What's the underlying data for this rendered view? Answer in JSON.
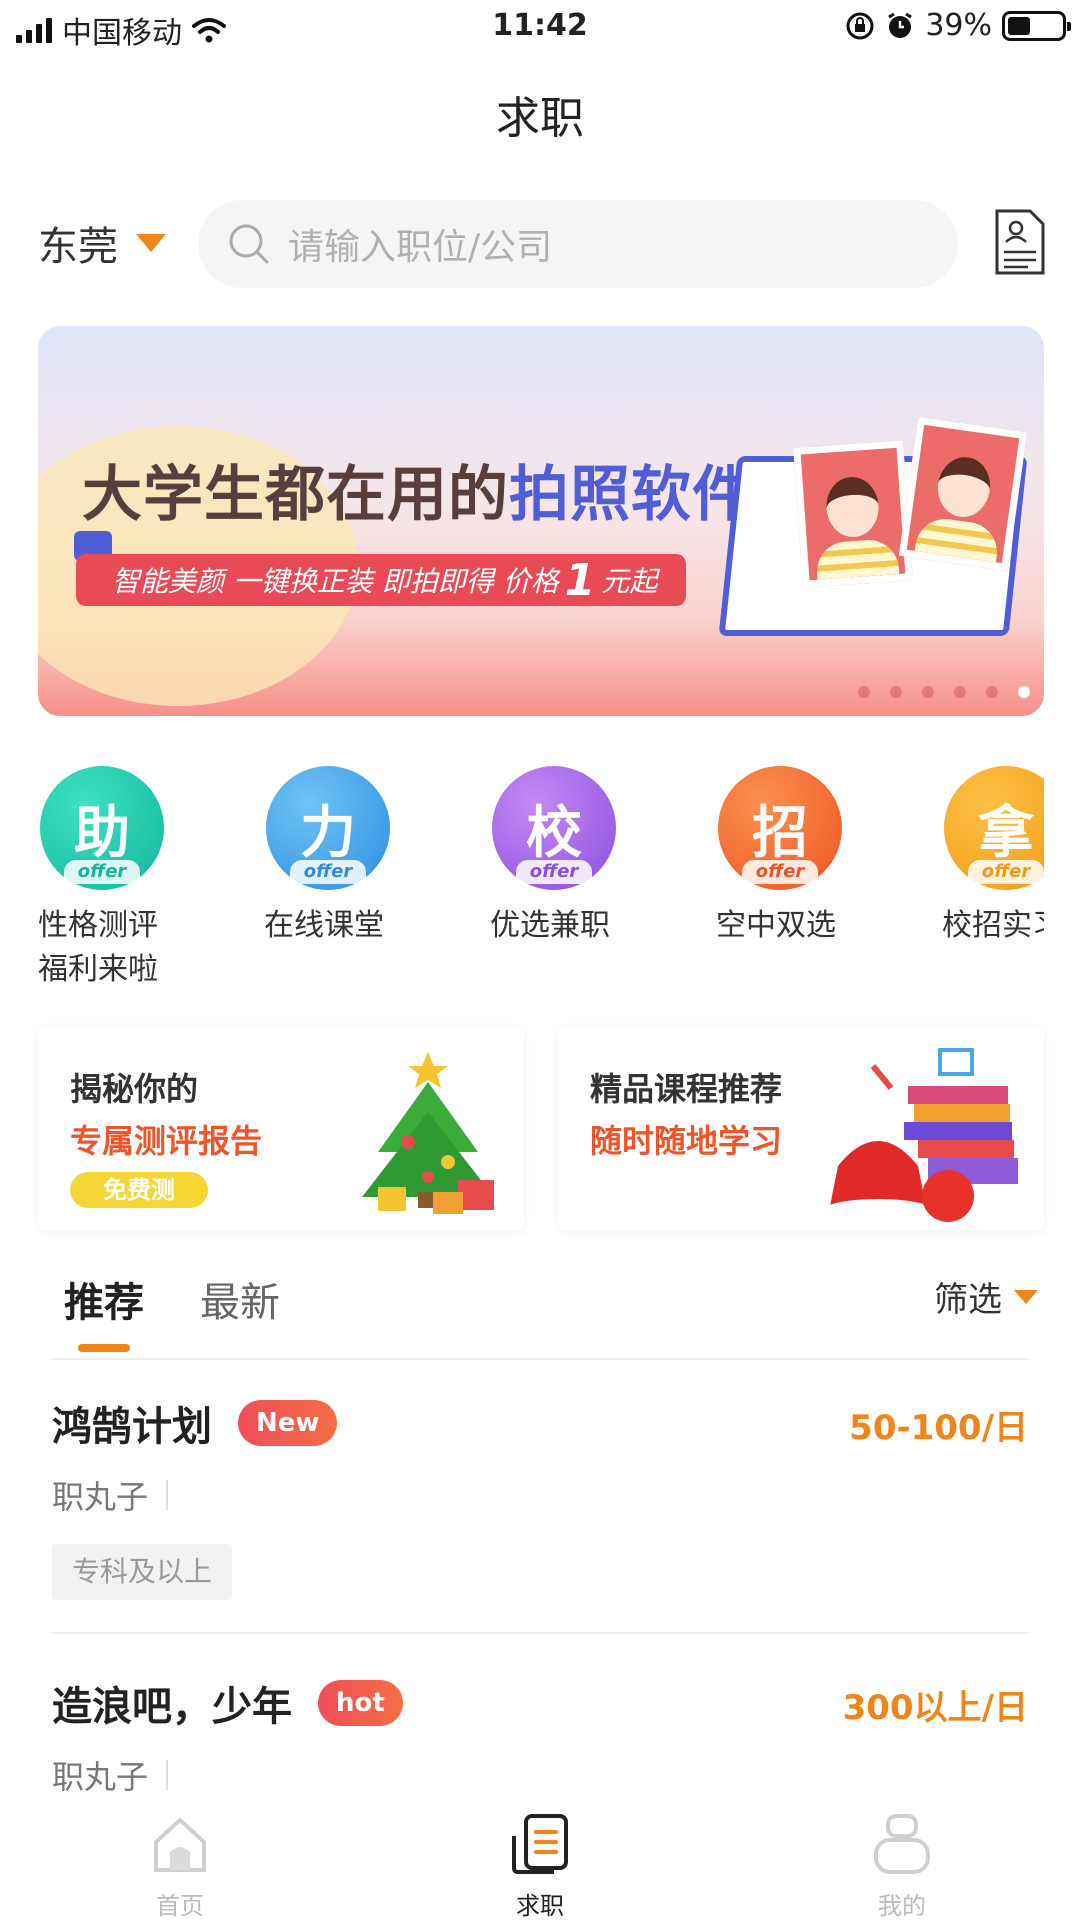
{
  "status_bar": {
    "carrier": "中国移动",
    "time": "11:42",
    "battery": "39%"
  },
  "header": {
    "title": "求职"
  },
  "search": {
    "city": "东莞",
    "placeholder": "请输入职位/公司"
  },
  "banner": {
    "headline_part1": "大学生都在用的",
    "headline_part2": "拍照软件",
    "sub_part1": "智能美颜 一键换正装 即拍即得  价格",
    "sub_price": "1",
    "sub_part2": "元起",
    "page_count": 6,
    "active_page": 6
  },
  "categories": [
    {
      "glyph": "助",
      "offer": "offer",
      "label1": "性格测评",
      "label2": "福利来啦",
      "color_a": "#3fe0c4",
      "color_b": "#11b79a"
    },
    {
      "glyph": "力",
      "offer": "offer",
      "label1": "在线课堂",
      "label2": "",
      "color_a": "#6fc4f6",
      "color_b": "#2d8de0"
    },
    {
      "glyph": "校",
      "offer": "offer",
      "label1": "优选兼职",
      "label2": "",
      "color_a": "#c58af4",
      "color_b": "#8a4ee0"
    },
    {
      "glyph": "招",
      "offer": "offer",
      "label1": "空中双选",
      "label2": "",
      "color_a": "#fb9050",
      "color_b": "#ef5520"
    },
    {
      "glyph": "拿",
      "offer": "offer",
      "label1": "校招实习",
      "label2": "",
      "color_a": "#fdc046",
      "color_b": "#f39a12"
    }
  ],
  "promo_cards": [
    {
      "line1": "揭秘你的",
      "line2": "专属测评报告",
      "pill": "免费测"
    },
    {
      "line1": "精品课程推荐",
      "line2": "随时随地学习",
      "pill": ""
    }
  ],
  "tabs": {
    "recommended": "推荐",
    "latest": "最新",
    "filter": "筛选"
  },
  "jobs": [
    {
      "title": "鸿鹄计划",
      "badge": "New",
      "pay": "50-100/日",
      "company": "职丸子",
      "requirement": "专科及以上"
    },
    {
      "title": "造浪吧，少年",
      "badge": "hot",
      "pay": "300以上/日",
      "company": "职丸子",
      "requirement": ""
    }
  ],
  "bottom_nav": [
    {
      "label": "首页",
      "active": false
    },
    {
      "label": "求职",
      "active": true
    },
    {
      "label": "我的",
      "active": false
    }
  ],
  "colors": {
    "accent": "#f08519",
    "highlight_red": "#f0552a",
    "badge_red": "#f04d58"
  }
}
